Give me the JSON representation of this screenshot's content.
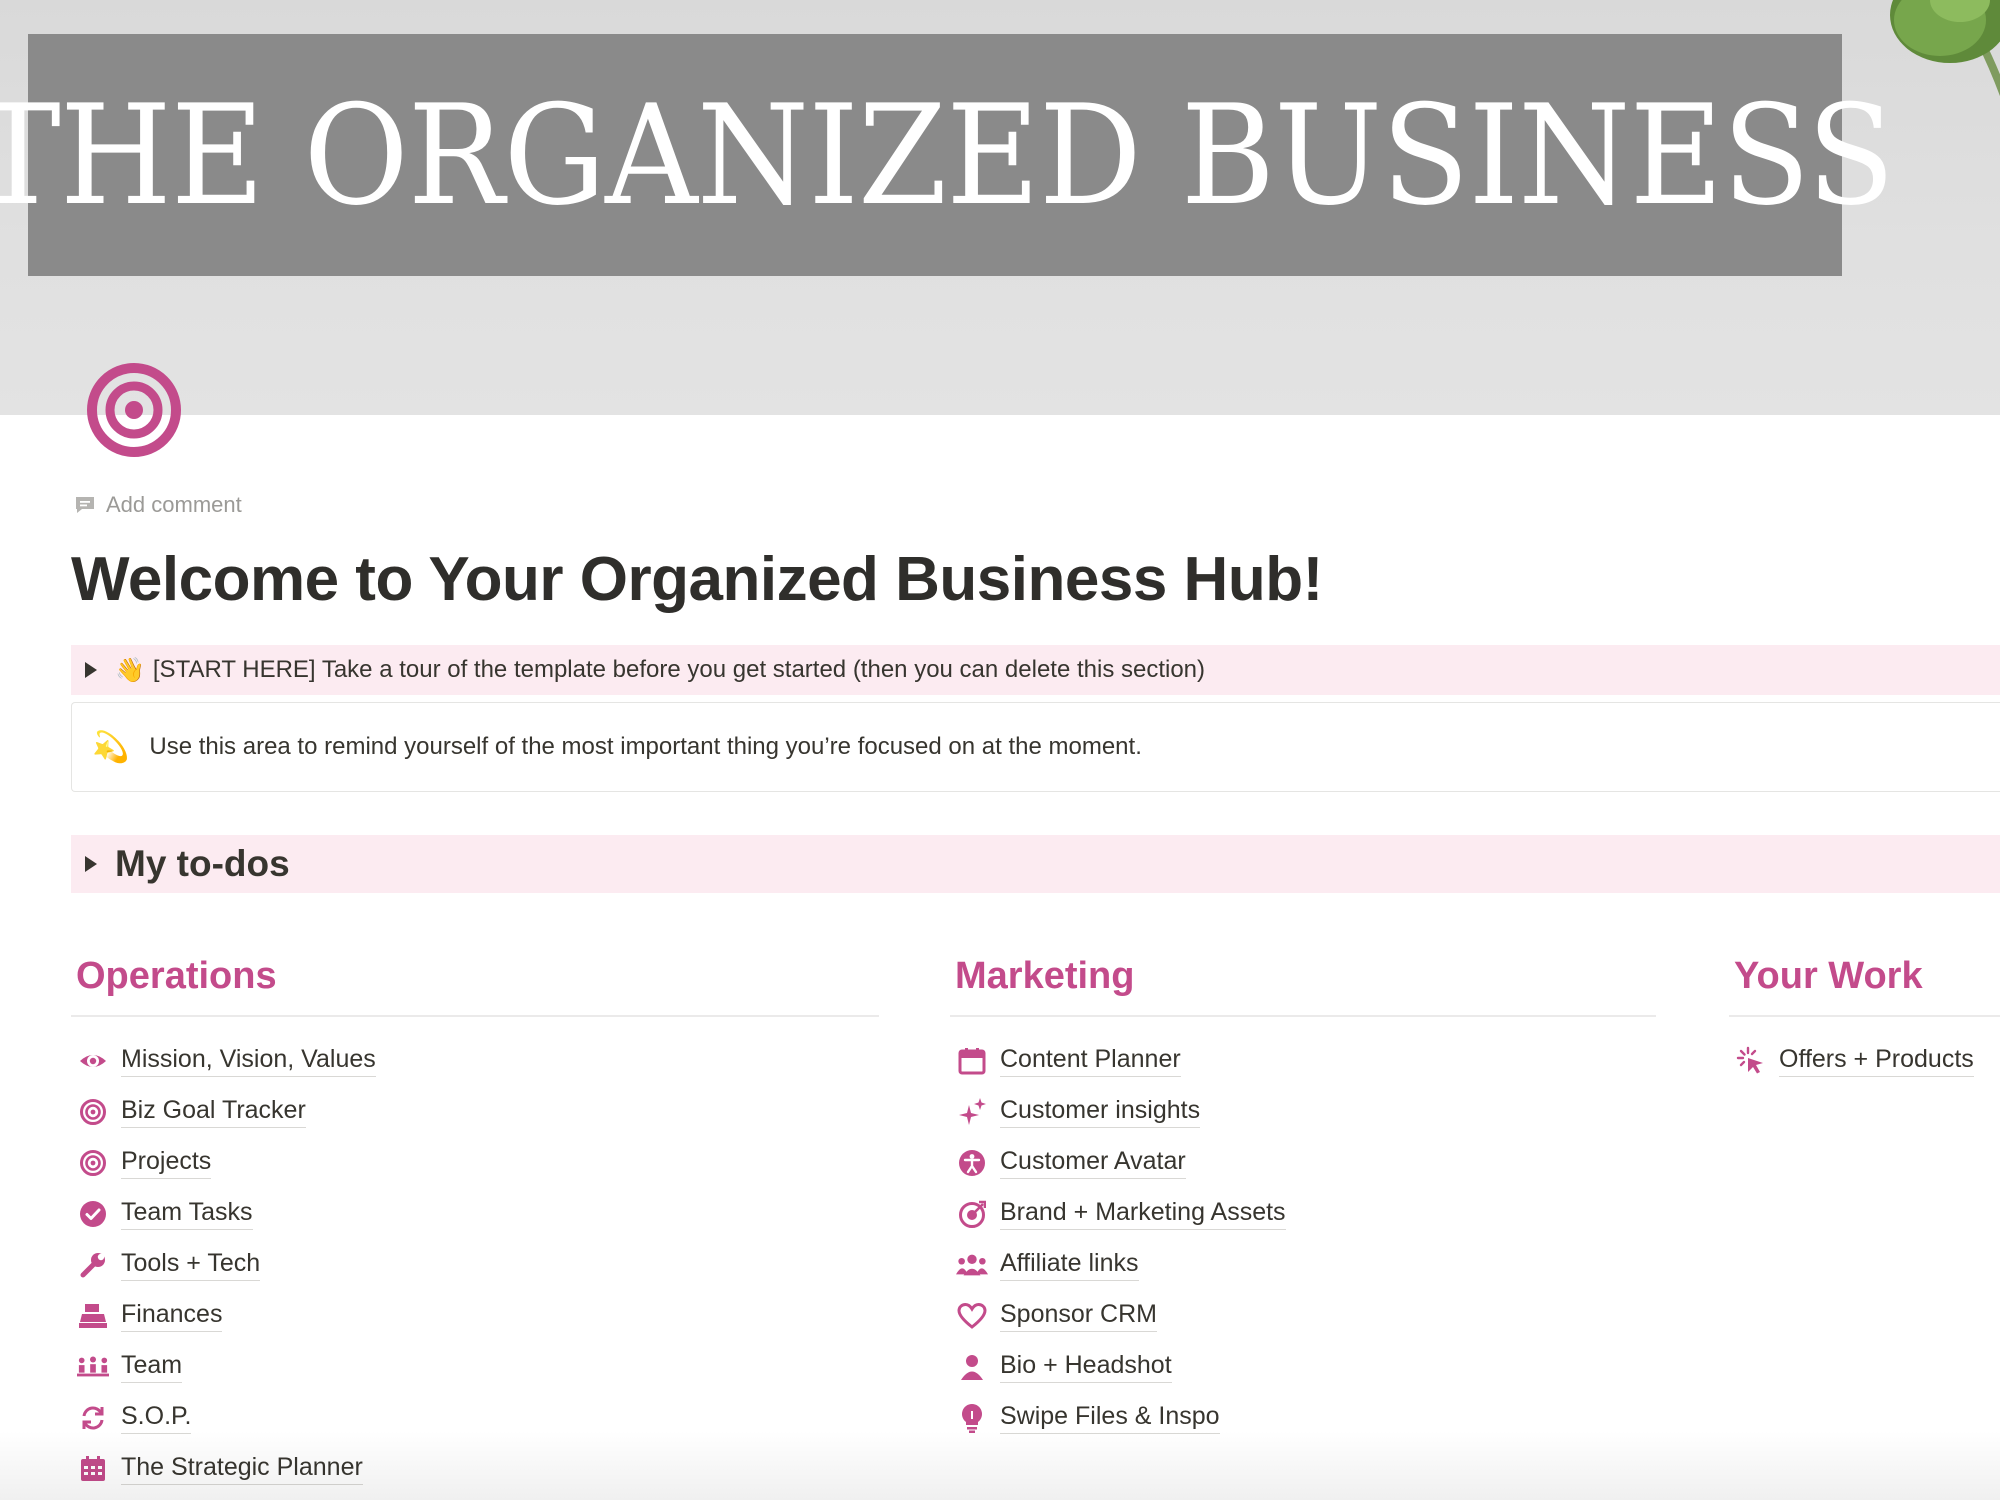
{
  "cover": {
    "title": "THE ORGANIZED BUSINESS"
  },
  "page": {
    "icon": "target-icon",
    "add_comment": "Add comment",
    "title": "Welcome to Your Organized Business Hub!",
    "start_toggle": {
      "emoji": "👋",
      "label": "[START HERE] Take a tour of the template before you get started (then you can delete this section)"
    },
    "callout": {
      "emoji": "💫",
      "text": "Use this area to remind yourself of the most important thing you’re focused on at the moment."
    },
    "todos_toggle": {
      "label": "My to-dos"
    }
  },
  "accent_color": "#c34b8b",
  "columns": {
    "operations": {
      "heading": "Operations",
      "items": [
        {
          "label": "Mission, Vision, Values",
          "icon": "eye-icon"
        },
        {
          "label": "Biz Goal Tracker",
          "icon": "target-icon"
        },
        {
          "label": "Projects",
          "icon": "target-icon"
        },
        {
          "label": "Team Tasks",
          "icon": "check-circle-icon"
        },
        {
          "label": "Tools + Tech",
          "icon": "wrench-icon"
        },
        {
          "label": "Finances",
          "icon": "cash-register-icon"
        },
        {
          "label": "Team",
          "icon": "group-icon"
        },
        {
          "label": "S.O.P.",
          "icon": "refresh-icon"
        },
        {
          "label": "The Strategic Planner",
          "icon": "calendar-grid-icon"
        }
      ]
    },
    "marketing": {
      "heading": "Marketing",
      "items": [
        {
          "label": "Content Planner",
          "icon": "calendar-icon"
        },
        {
          "label": "Customer insights",
          "icon": "sparkle-icon"
        },
        {
          "label": "Customer Avatar",
          "icon": "accessibility-icon"
        },
        {
          "label": "Brand + Marketing Assets",
          "icon": "target-arrow-icon"
        },
        {
          "label": "Affiliate links",
          "icon": "people-icon"
        },
        {
          "label": "Sponsor CRM",
          "icon": "heart-icon"
        },
        {
          "label": "Bio + Headshot",
          "icon": "person-icon"
        },
        {
          "label": "Swipe Files & Inspo",
          "icon": "lightbulb-icon"
        }
      ]
    },
    "your_work": {
      "heading": "Your Work",
      "items": [
        {
          "label": "Offers + Products",
          "icon": "cursor-click-icon"
        }
      ]
    }
  }
}
